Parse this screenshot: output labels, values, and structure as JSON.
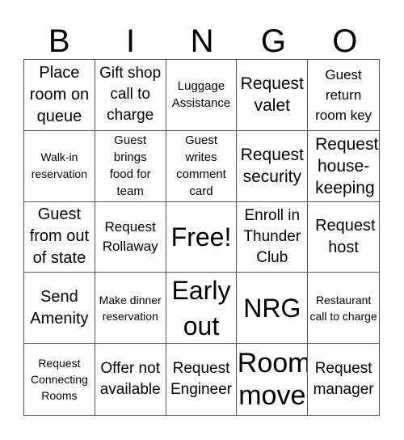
{
  "title_letters": [
    "B",
    "I",
    "N",
    "G",
    "O"
  ],
  "cells": [
    "Place room on queue",
    "Gift shop call to charge",
    "Luggage Assistance",
    "Request valet",
    "Guest return room key",
    "Walk-in reservation",
    "Guest brings food for team",
    "Guest writes comment card",
    "Request security",
    "Request house-keeping",
    "Guest from out of state",
    "Request Rollaway",
    "Free!",
    "Enroll in Thunder Club",
    "Request host",
    "Send Amenity",
    "Make dinner reservation",
    "Early out",
    "NRG",
    "Restaurant call to charge",
    "Request Connecting Rooms",
    "Offer not available",
    "Request Engineer",
    "Room move",
    "Request manager"
  ]
}
